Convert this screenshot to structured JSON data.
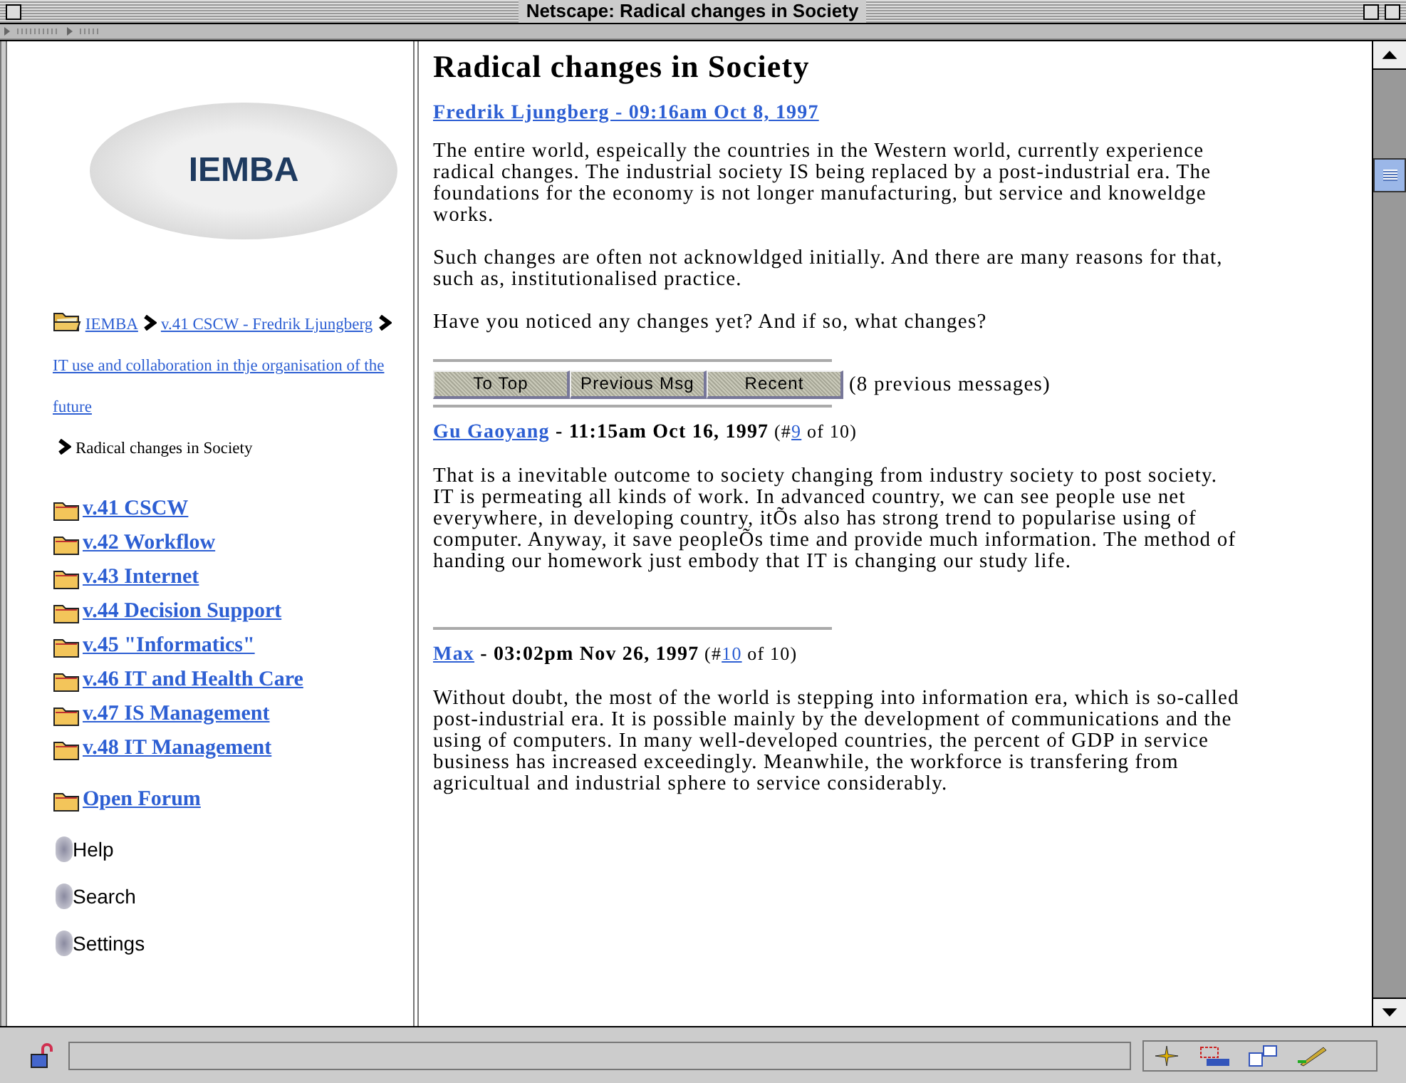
{
  "window": {
    "title": "Netscape: Radical changes in Society"
  },
  "sidebar": {
    "logo": "IEMBA",
    "breadcrumb": [
      {
        "kind": "link",
        "text": "IEMBA"
      },
      {
        "kind": "link",
        "text": "v.41 CSCW - Fredrik Ljungberg"
      },
      {
        "kind": "link",
        "text": "IT use and collaboration in thje organisation of the future"
      },
      {
        "kind": "current",
        "text": "Radical changes in Society"
      }
    ],
    "forums": [
      "v.41 CSCW",
      "v.42 Workflow",
      "v.43 Internet",
      "v.44 Decision Support",
      "v.45 \"Informatics\"",
      "v.46 IT and Health Care",
      "v.47 IS Management",
      "v.48 IT Management"
    ],
    "open_forum": "Open Forum",
    "tools": [
      "Help",
      "Search",
      "Settings"
    ]
  },
  "article": {
    "title": "Radical changes in Society",
    "author_line": "Fredrik Ljungberg - 09:16am Oct 8, 1997",
    "paragraphs": [
      "The entire world, espeically the countries in the Western world, currently experience radical changes. The industrial society IS being replaced by a post-industrial era. The foundations for the economy is not longer manufacturing, but service and knoweldge works.",
      "Such changes are often not acknowldged initially. And there are many reasons for that, such as, institutionalised practice.",
      "Have you noticed any changes yet? And if so, what changes?"
    ]
  },
  "nav_buttons": [
    "To Top",
    "Previous Msg",
    "Recent"
  ],
  "previous_count": "(8 previous messages)",
  "messages": [
    {
      "author": "Gu Gaoyang",
      "time": " - 11:15am Oct 16, 1997",
      "number_prefix": " (#",
      "number": "9",
      "number_suffix": " of 10)",
      "body": "That is a inevitable outcome to society changing from industry society to post society. IT is permeating all kinds of work. In advanced country, we can see people use net everywhere, in developing country, itÕs also has strong trend to popularise using of computer. Anyway, it save peopleÕs time and provide much information. The method of handing our homework just embody that IT is changing our study life."
    },
    {
      "author": "Max",
      "time": " - 03:02pm Nov 26, 1997",
      "number_prefix": " (#",
      "number": "10",
      "number_suffix": " of 10)",
      "body": "Without doubt, the most of the world is stepping into information era, which is so-called post-industrial era. It is possible mainly by the development of communications and the using of computers. In many well-developed countries, the percent of GDP in service business has increased exceedingly. Meanwhile, the workforce is transfering from agricultual and industrial sphere to service considerably."
    }
  ]
}
